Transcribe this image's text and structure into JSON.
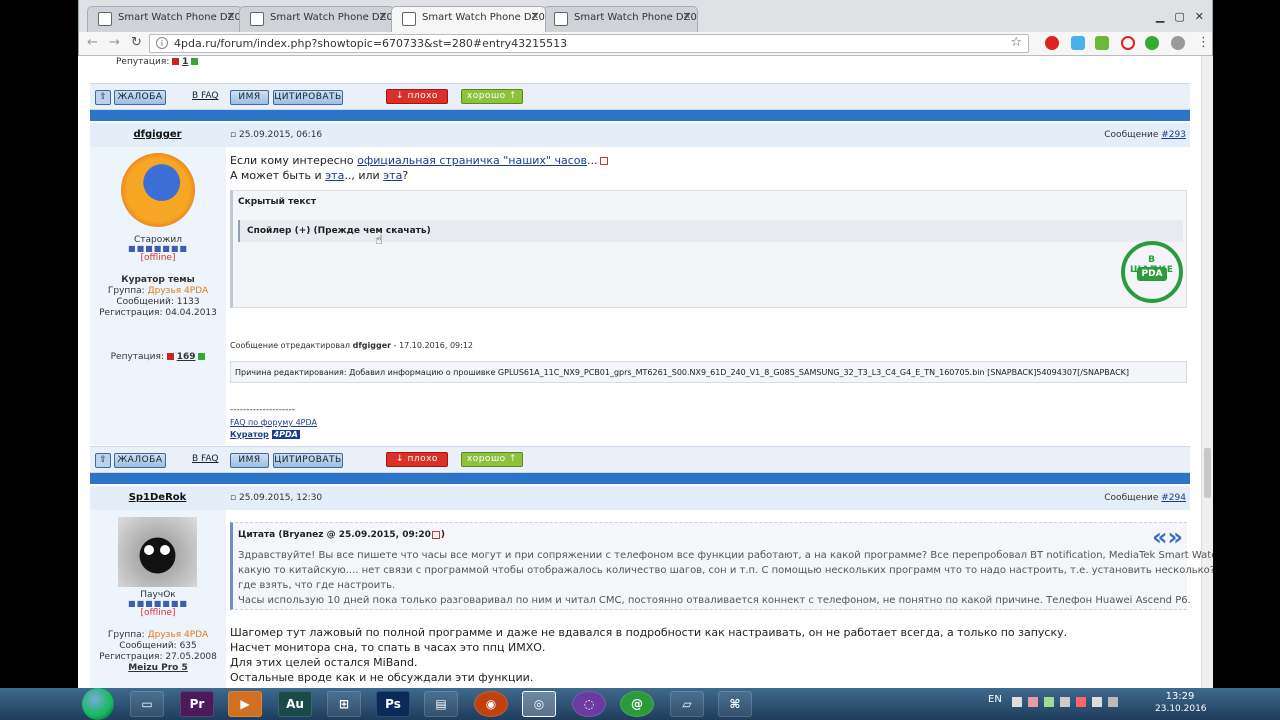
{
  "browser": {
    "tabs": [
      {
        "title": "Smart Watch Phone DZ0",
        "active": false
      },
      {
        "title": "Smart Watch Phone DZ0",
        "active": false
      },
      {
        "title": "Smart Watch Phone DZ0",
        "active": true
      },
      {
        "title": "Smart Watch Phone DZ0",
        "active": false
      }
    ],
    "url": "4pda.ru/forum/index.php?showtopic=670733&st=280#entry43215513",
    "back": "←",
    "forward": "→",
    "reload": "↻",
    "star": "☆"
  },
  "top_rep": {
    "label": "Репутация:",
    "value": "1"
  },
  "buttons": {
    "complaint": "ЖАЛОБА",
    "faq": "В FAQ",
    "name": "ИМЯ",
    "quote": "ЦИТИРОВАТЬ",
    "bad": "↓ плохо",
    "good": "хорошо ↑",
    "up": "⇧"
  },
  "post1": {
    "author": "dfgigger",
    "date": "25.09.2015, 06:16",
    "msg_label": "Сообщение ",
    "msg_no": "#293",
    "status": "Старожил",
    "dots": "■■■■■■■",
    "offline": "[offline]",
    "role": "Куратор темы",
    "group_label": "Группа: ",
    "group": "Друзья 4PDA",
    "posts": "Сообщений: 1133",
    "reg": "Регистрация: 04.04.2013",
    "rep_label": "Репутация:",
    "rep": "169",
    "line1_pre": "Если кому интересно ",
    "line1_link": "официальная страничка \"наших\" часов",
    "line1_post": "...",
    "line2_pre": "А может быть и ",
    "line2_link1": "эта",
    "line2_mid": ".., или ",
    "line2_link2": "эта",
    "line2_post": "?",
    "hidden_title": "Скрытый текст",
    "spoiler": "Спойлер (+) (Прежде чем скачать)",
    "stamp_text": "В ШАПКЕ",
    "stamp_center": "PDA",
    "edited_pre": "Сообщение отредактировал ",
    "edited_by": "dfgigger",
    "edited_date": " - 17.10.2016, 09:12",
    "reason": "Причина редактирования: Добавил информацию о прошивке GPLUS61A_11C_NX9_PCB01_gprs_MT6261_S00.NX9_61D_240_V1_8_G08S_SAMSUNG_32_T3_L3_C4_G4_E_TN_160705.bin [SNAPBACK]54094307[/SNAPBACK]",
    "sig_line": "--------------------",
    "sig_faq": "FAQ по форуму 4PDA",
    "sig_curator": "Куратор",
    "sig_logo": "4PDA"
  },
  "post2": {
    "author": "Sp1DeRok",
    "date": "25.09.2015, 12:30",
    "msg_label": "Сообщение ",
    "msg_no": "#294",
    "status": "ПаучОк",
    "dots": "■■■■■■■",
    "offline": "[offline]",
    "group_label": "Группа: ",
    "group": "Друзья 4PDA",
    "posts": "Сообщений: 635",
    "reg": "Регистрация: 27.05.2008",
    "device": "Meizu Pro 5",
    "quote_title": "Цитата (Bryanez @ 25.09.2015, 09:20",
    "quote_close": ")",
    "quote_mark": "«»",
    "quote_l1": "Здравствуйте! Вы все пишете что часы все могут и при сопряжении с телефоном все функции работают, а на какой программе? Все перепробовал BT notification, MediaTek Smart Watch,",
    "quote_l2": "какую то китайскую.... нет связи с программой чтобы отображалось количество шагов, сон и т.п. С помощью нескольких программ что то надо настроить, т.е. установить несколько? Какие,",
    "quote_l3": "где взять, что где настроить.",
    "quote_l4": "Часы использую 10 дней пока только разговаривал по ним и читал СМС, постоянно отваливается коннект с телефоном, не понятно по какой причине. Телефон Huawei Ascend P6.",
    "body_l1": "Шагомер тут лажовый по полной программе и даже не вдавался в подробности как настраивать, он не работает всегда, а только по запуску.",
    "body_l2": "Насчет монитора сна, то спать в часах это ппц ИМХО.",
    "body_l3": "Для этих целей остался MiBand.",
    "body_l4": "Остальные вроде как и не обсуждали эти функции."
  },
  "taskbar": {
    "apps": [
      "▭",
      "Pr",
      "▶",
      "Au",
      "⊞",
      "Ps",
      "▤",
      "◉",
      "◎",
      "◌",
      "@",
      "▱",
      "⌘"
    ],
    "lang": "EN",
    "time": "13:29",
    "date": "23.10.2016"
  }
}
